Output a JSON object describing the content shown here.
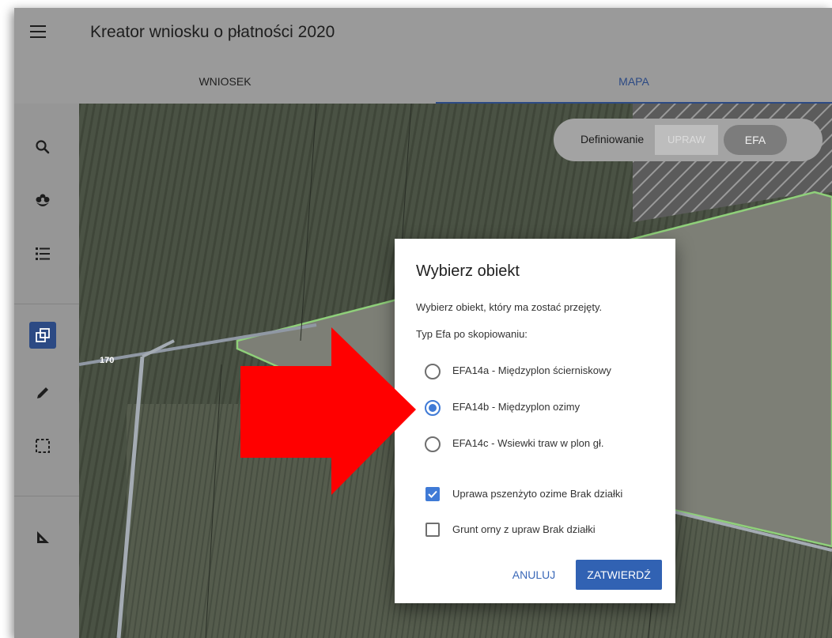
{
  "app": {
    "title": "Kreator wniosku o płatności 2020",
    "menu_icon": "hamburger-menu-icon"
  },
  "tabs": [
    {
      "label": "WNIOSEK",
      "active": false
    },
    {
      "label": "MAPA",
      "active": true
    }
  ],
  "sidebar": {
    "tools": [
      {
        "icon": "search-icon",
        "active": false
      },
      {
        "icon": "flower-icon",
        "active": false
      },
      {
        "icon": "list-icon",
        "active": false
      },
      {
        "icon": "copy-object-icon",
        "active": true
      },
      {
        "icon": "pencil-icon",
        "active": false
      },
      {
        "icon": "select-area-icon",
        "active": false
      },
      {
        "icon": "measure-ruler-icon",
        "active": false
      }
    ]
  },
  "map": {
    "parcel_label": "170",
    "mode_toggle": {
      "label": "Definiowanie",
      "options": [
        "UPRAW",
        "EFA"
      ],
      "selected": "EFA"
    }
  },
  "dialog": {
    "title": "Wybierz obiekt",
    "subtitle": "Wybierz obiekt, który ma zostać przejęty.",
    "type_label": "Typ Efa po skopiowaniu:",
    "options": [
      {
        "label": "EFA14a - Międzyplon ścierniskowy",
        "selected": false
      },
      {
        "label": "EFA14b - Międzyplon ozimy",
        "selected": true
      },
      {
        "label": "EFA14c - Wsiewki traw w plon gł.",
        "selected": false
      }
    ],
    "checkboxes": [
      {
        "label": "Uprawa pszenżyto ozime Brak działki",
        "checked": true
      },
      {
        "label": "Grunt orny z upraw Brak działki",
        "checked": false
      }
    ],
    "cancel_label": "ANULUJ",
    "confirm_label": "ZATWIERDŹ"
  },
  "colors": {
    "accent": "#3f7ad6",
    "primary_button": "#3162b3",
    "tab_active": "#2c4a84",
    "annotation_arrow": "#ff0000"
  }
}
